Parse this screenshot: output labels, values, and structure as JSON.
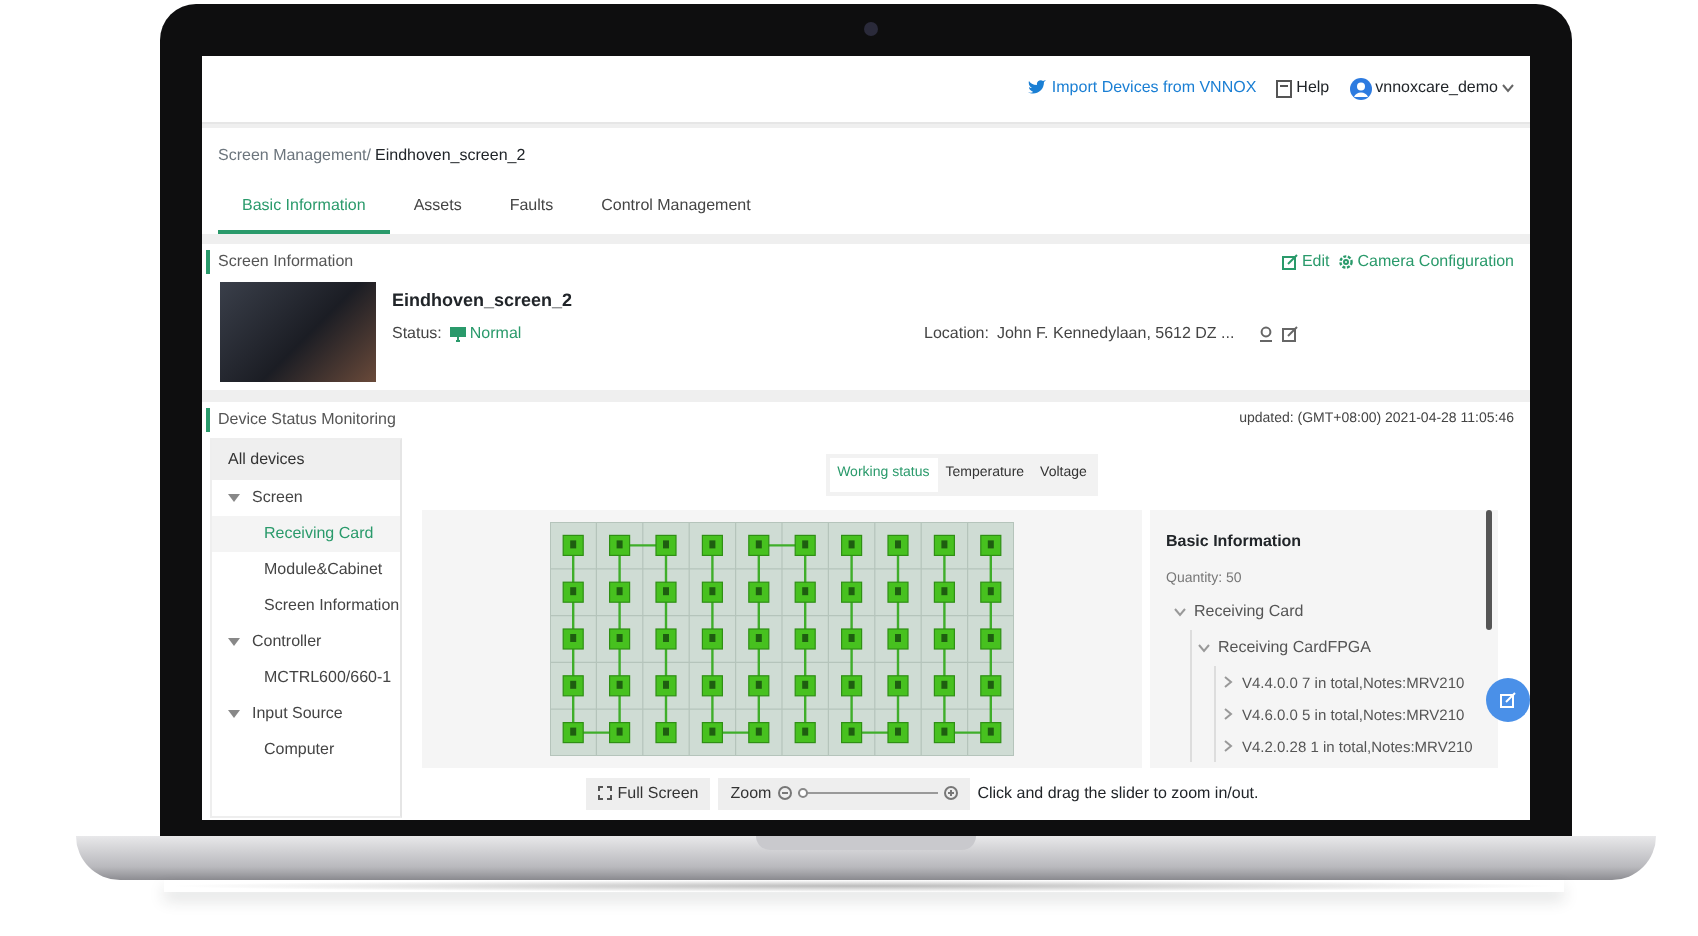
{
  "topbar": {
    "import_link": "Import Devices from VNNOX",
    "help_link": "Help",
    "user": "vnnoxcare_demo"
  },
  "breadcrumb": {
    "parent": "Screen Management/",
    "current": "Eindhoven_screen_2"
  },
  "tabs": [
    {
      "label": "Basic Information",
      "selected": true
    },
    {
      "label": "Assets",
      "selected": false
    },
    {
      "label": "Faults",
      "selected": false
    },
    {
      "label": "Control Management",
      "selected": false
    }
  ],
  "screen_information": {
    "title": "Screen Information",
    "actions": [
      {
        "kind": "edit",
        "label": "Edit"
      },
      {
        "kind": "camera",
        "label": "Camera Configuration"
      }
    ],
    "name": "Eindhoven_screen_2",
    "status_label": "Status:",
    "status": "Normal",
    "location_label": "Location:",
    "location": "John F. Kennedylaan, 5612 DZ ..."
  },
  "device_status": {
    "title": "Device Status Monitoring",
    "updated": "updated: (GMT+08:00) 2021-04-28 11:05:46",
    "sidebar": {
      "header": "All devices",
      "items": [
        {
          "label": "Screen",
          "expanded": true,
          "selected": false,
          "children": [
            {
              "label": "Receiving Card",
              "selected": true
            },
            {
              "label": "Module&Cabinet",
              "selected": false
            },
            {
              "label": "Screen Information",
              "selected": false
            }
          ]
        },
        {
          "label": "Controller",
          "expanded": true,
          "selected": false,
          "children": [
            {
              "label": "MCTRL600/660-1",
              "selected": false
            }
          ]
        },
        {
          "label": "Input Source",
          "expanded": true,
          "selected": false,
          "children": [
            {
              "label": "Computer",
              "selected": false
            }
          ]
        }
      ]
    },
    "view_tabs": [
      {
        "label": "Working status",
        "selected": true
      },
      {
        "label": "Temperature",
        "selected": false
      },
      {
        "label": "Voltage",
        "selected": false
      }
    ],
    "toolbar": {
      "full_screen": "Full Screen",
      "zoom_label": "Zoom",
      "zoom": {
        "level": 0
      },
      "hint": "Click and drag the slider to zoom in/out."
    },
    "info_panel": {
      "title": "Basic Information",
      "quantity": "Quantity: 50",
      "tree": [
        {
          "label": "Receiving Card",
          "expanded": true,
          "children": [
            {
              "label": "Receiving CardFPGA",
              "expanded": true,
              "children": [
                {
                  "label": "V4.4.0.0 7 in total,Notes:MRV210",
                  "expanded": false
                },
                {
                  "label": "V4.6.0.0 5 in total,Notes:MRV210",
                  "expanded": false
                },
                {
                  "label": "V4.2.0.28 1 in total,Notes:MRV210",
                  "expanded": false
                }
              ]
            }
          ]
        }
      ]
    }
  }
}
